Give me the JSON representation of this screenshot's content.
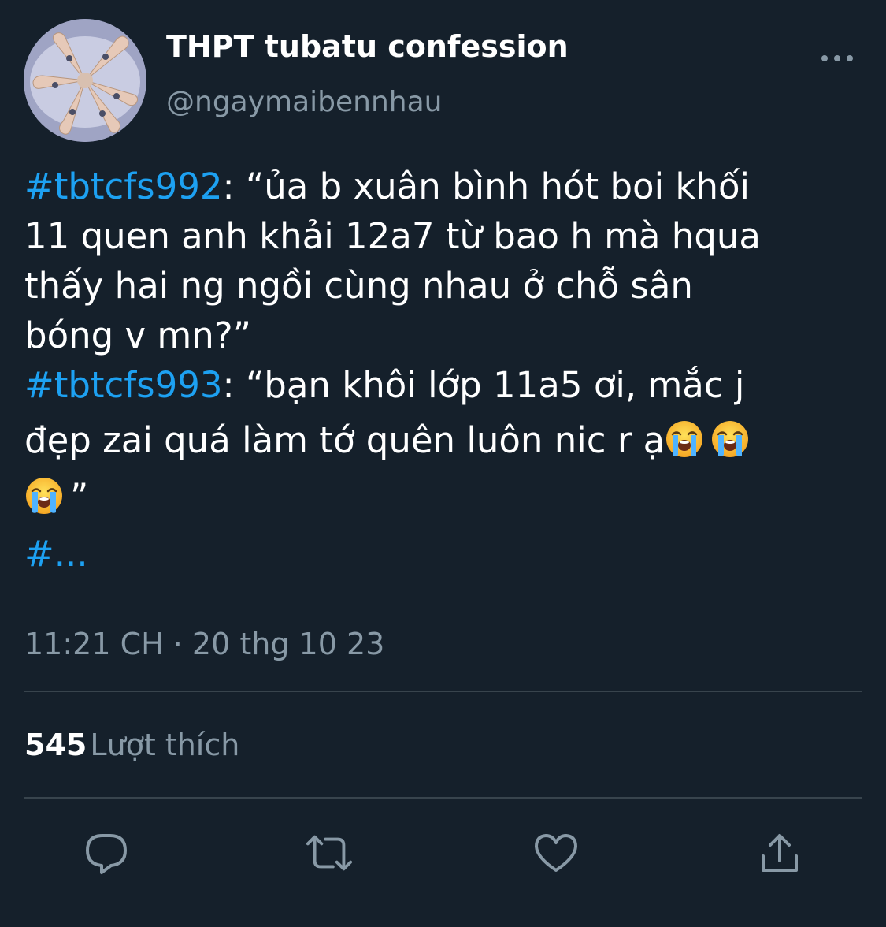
{
  "account": {
    "name": "THPT tubatu confession",
    "handle": "@ngaymaibennhau"
  },
  "header": {
    "more_icon": "more-horizontal-icon"
  },
  "tweet": {
    "p1_tag": "#tbtcfs992",
    "p1_l1": ": “ủa b xuân bình hót boi khối",
    "p1_l2": "11 quen anh khải 12a7 từ bao h mà hqua",
    "p1_l3": "thấy hai ng ngồi cùng nhau ở chỗ sân",
    "p1_l4": "bóng v mn?”",
    "p2_tag": "#tbtcfs993",
    "p2_l1": ": “bạn khôi lớp 11a5 ơi, mắc j",
    "p2_l2": "đẹp zai quá làm tớ quên luôn nic r ạ",
    "p2_l3": "”",
    "p3_tag": "#...",
    "emoji_name": "loudly-crying-face-emoji"
  },
  "meta": {
    "timestamp": "11:21 CH · 20 thg 10 23"
  },
  "stats": {
    "likes_count": "545",
    "likes_label": "Lượt thích"
  },
  "actions": {
    "reply_icon": "reply-icon",
    "retweet_icon": "retweet-icon",
    "like_icon": "heart-icon",
    "share_icon": "share-icon"
  },
  "colors": {
    "background": "#15202b",
    "text": "#ffffff",
    "secondary": "#8899a6",
    "link": "#1da1f2",
    "divider": "#38444d"
  }
}
